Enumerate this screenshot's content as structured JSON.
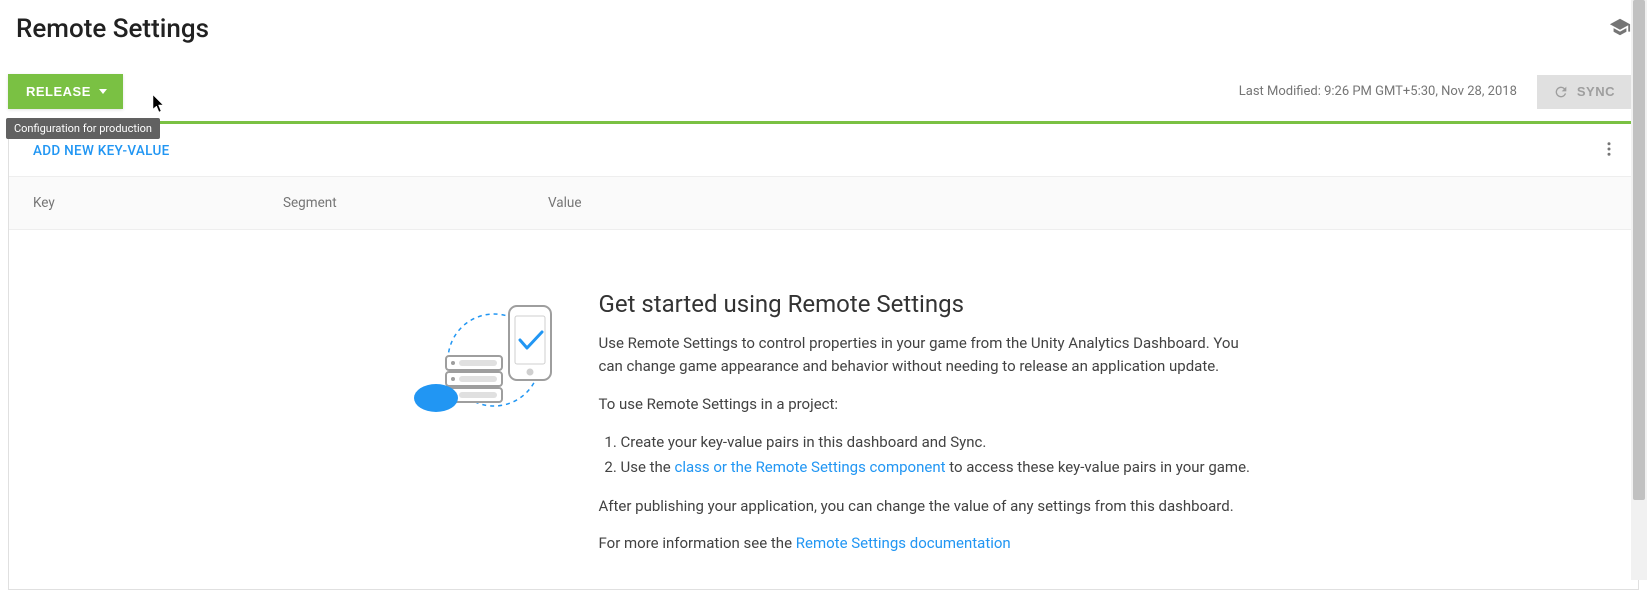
{
  "header": {
    "title": "Remote Settings"
  },
  "actions": {
    "release_label": "RELEASE",
    "tooltip": "Configuration for production",
    "last_modified": "Last Modified: 9:26 PM GMT+5:30, Nov 28, 2018",
    "sync_label": "SYNC"
  },
  "table": {
    "add_link": "ADD NEW KEY-VALUE",
    "columns": {
      "key": "Key",
      "segment": "Segment",
      "value": "Value"
    }
  },
  "empty": {
    "heading": "Get started using Remote Settings",
    "intro": "Use Remote Settings to control properties in your game from the Unity Analytics Dashboard. You can change game appearance and behavior without needing to release an application update.",
    "howto": "To use Remote Settings in a project:",
    "step1": "Create your key-value pairs in this dashboard and Sync.",
    "step2a": "Use the ",
    "step2_link": "class or the Remote Settings component",
    "step2b": " to access these key-value pairs in your game.",
    "after": "After publishing your application, you can change the value of any settings from this dashboard.",
    "more_a": "For more information see the ",
    "more_link": "Remote Settings documentation"
  }
}
